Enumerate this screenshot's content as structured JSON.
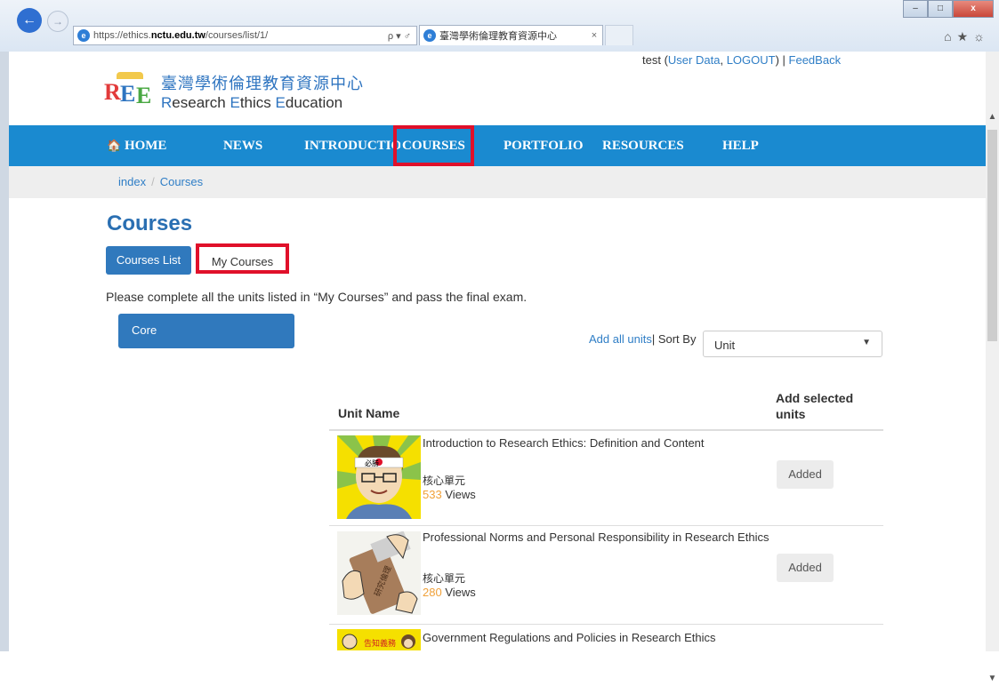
{
  "browser": {
    "url_prefix": "https://ethics.",
    "url_host": "nctu.edu.tw",
    "url_path": "/courses/list/1/",
    "address_controls": "ρ ▾ ♂",
    "tab_title": "臺灣學術倫理教育資源中心",
    "tab_close": "×",
    "back_glyph": "←",
    "forward_glyph": "→",
    "minimize": "–",
    "maximize": "□",
    "close": "x",
    "toolbar_icons": "⌂★☼"
  },
  "userbar": {
    "user": "test",
    "open_paren": " (",
    "user_data": "User Data",
    "comma": ", ",
    "logout": "LOGOUT",
    "close_paren": ") | ",
    "feedback": "FeedBack"
  },
  "logo": {
    "mark_letters": [
      "R",
      "E",
      "E"
    ],
    "zh_name": "臺灣學術倫理教育資源中心",
    "en_r": "R",
    "en_rest1": "esearch ",
    "en_e1": "E",
    "en_rest2": "thics ",
    "en_e2": "E",
    "en_rest3": "ducation"
  },
  "nav": {
    "home_icon": "🏠",
    "home": "HOME",
    "news": "NEWS",
    "introduction": "INTRODUCTION",
    "courses": "COURSES",
    "portfolio": "PORTFOLIO",
    "resources": "RESOURCES",
    "help": "HELP"
  },
  "breadcrumb": {
    "index": "index",
    "sep": "/",
    "current": "Courses"
  },
  "page": {
    "title": "Courses",
    "btn_courses_list": "Courses List",
    "btn_my_courses": "My Courses",
    "instruction": "Please complete all the units listed in “My Courses” and pass the final exam.",
    "core_panel": "Core",
    "add_all_units": "Add all units",
    "sort_by": " | Sort By",
    "sort_value": "Unit",
    "sort_caret": "▼"
  },
  "table": {
    "col_unit_name": "Unit Name",
    "col_add_selected": "Add selected units",
    "rows": [
      {
        "title": "Introduction to Research Ethics: Definition and Content",
        "category": "核心單元",
        "views_num": "533",
        "views_label": " Views",
        "action": "Added",
        "thumb_badge": "必勝"
      },
      {
        "title": "Professional Norms and Personal Responsibility in Research Ethics",
        "category": "核心單元",
        "views_num": "280",
        "views_label": " Views",
        "action": "Added",
        "thumb_badge": ""
      },
      {
        "title": "Government Regulations and Policies in Research Ethics",
        "category": "",
        "views_num": "",
        "views_label": "",
        "action": "",
        "thumb_badge": "告知義務"
      }
    ]
  }
}
